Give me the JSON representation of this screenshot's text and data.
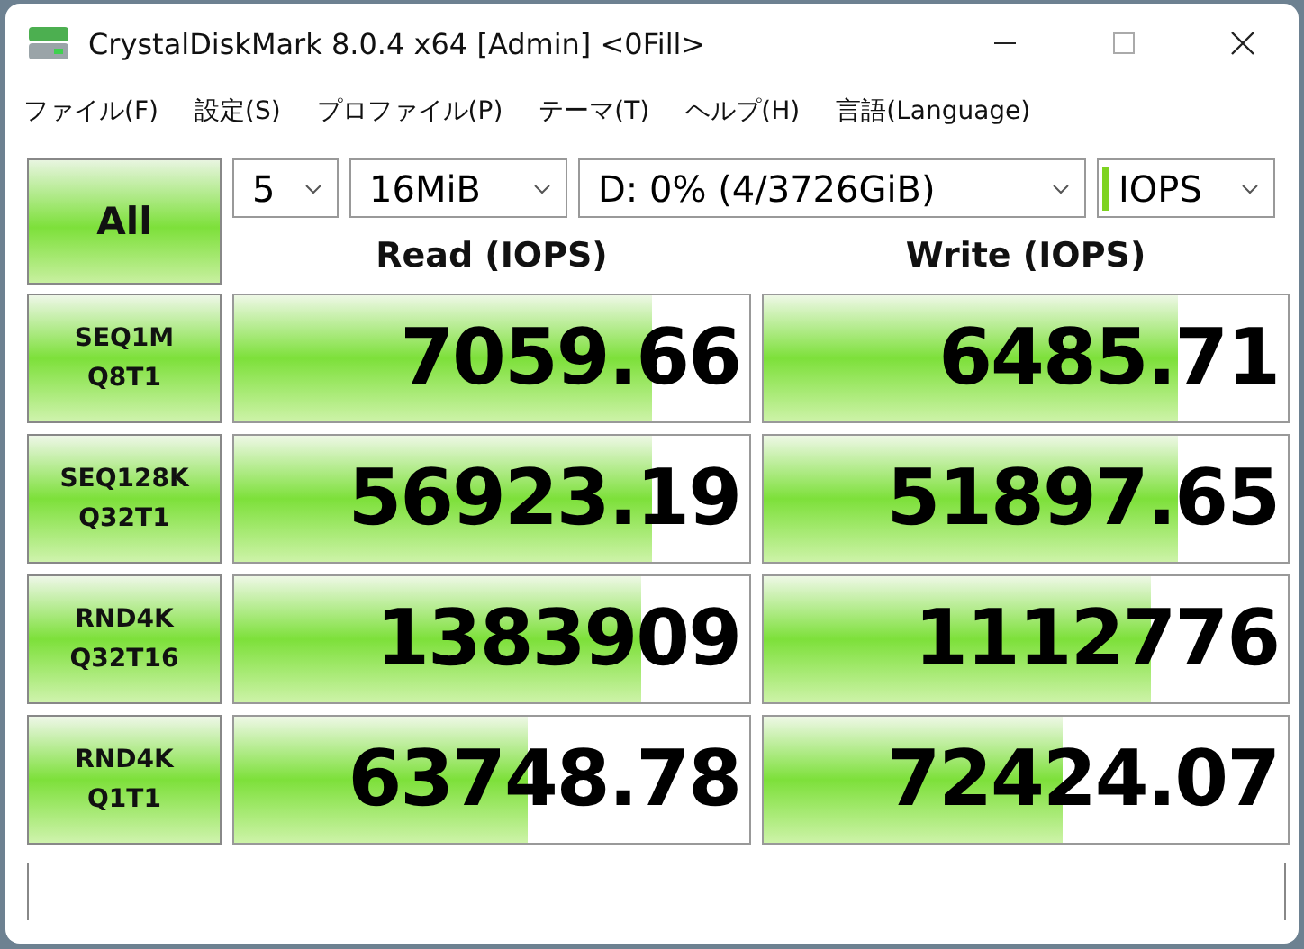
{
  "window": {
    "title": "CrystalDiskMark 8.0.4 x64 [Admin] <0Fill>"
  },
  "menu": [
    "ファイル(F)",
    "設定(S)",
    "プロファイル(P)",
    "テーマ(T)",
    "ヘルプ(H)",
    "言語(Language)"
  ],
  "controls": {
    "all_button": "All",
    "count": "5",
    "size": "16MiB",
    "drive": "D: 0% (4/3726GiB)",
    "unit": "IOPS"
  },
  "columns": [
    "Read (IOPS)",
    "Write (IOPS)"
  ],
  "rows": [
    {
      "test": "SEQ1M",
      "params": "Q8T1",
      "read": {
        "value": "7059.66",
        "level": 0.81
      },
      "write": {
        "value": "6485.71",
        "level": 0.79
      }
    },
    {
      "test": "SEQ128K",
      "params": "Q32T1",
      "read": {
        "value": "56923.19",
        "level": 0.81
      },
      "write": {
        "value": "51897.65",
        "level": 0.79
      }
    },
    {
      "test": "RND4K",
      "params": "Q32T16",
      "read": {
        "value": "1383909",
        "level": 0.79
      },
      "write": {
        "value": "1112776",
        "level": 0.74
      }
    },
    {
      "test": "RND4K",
      "params": "Q1T1",
      "read": {
        "value": "63748.78",
        "level": 0.57
      },
      "write": {
        "value": "72424.07",
        "level": 0.57
      }
    }
  ]
}
